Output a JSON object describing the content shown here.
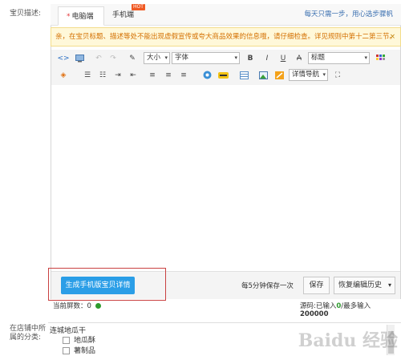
{
  "field_label": "宝贝描述:",
  "tabs": [
    {
      "star": "*",
      "label": "电脑端"
    },
    {
      "label": "手机端"
    }
  ],
  "hot_badge": "HOT",
  "top_tip": "每天只需一步，用心选步骤帆",
  "notice": {
    "text": "亲，在宝贝标题、描述等处不能出现虚假宣传或夸大商品效果的信息哦，请仔细检查。详见规则中第十二第三节。",
    "close": "×"
  },
  "toolbar": {
    "font_size": "大小",
    "font_family": "字体",
    "heading": "标题",
    "detail_nav": "详情导航",
    "bold": "B",
    "italic": "I",
    "underline": "U",
    "strike": "A"
  },
  "bottom_bar": {
    "generate_button": "生成手机版宝贝详情",
    "autosave_note": "每5分钟保存一次",
    "save_button": "保存",
    "history_button": "恢复编辑历史"
  },
  "status": {
    "screens_label": "当前屏数：",
    "screens_value": "0",
    "source_label": "源码:已输入",
    "source_value": "0",
    "max_label": "/最多输入",
    "max_value": "200000"
  },
  "category": {
    "label_line1": "在店铺中所",
    "label_line2": "属的分类:",
    "group": "连城地瓜干",
    "items": [
      "地瓜酥",
      "薯制品"
    ]
  },
  "watermark": "Baidu 经验",
  "colors": {
    "primary_button": "#2b9ee7",
    "notice_bg": "#fff8d9",
    "notice_text": "#d36f00",
    "highlight_border": "#c94040"
  }
}
